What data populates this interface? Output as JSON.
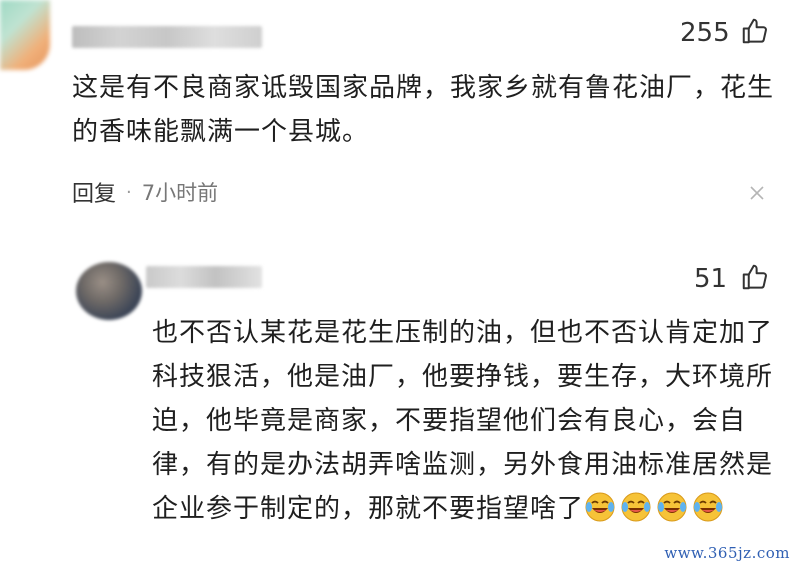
{
  "comments": [
    {
      "like_count": "255",
      "text": "这是有不良商家诋毁国家品牌，我家乡就有鲁花油厂，花生的香味能飘满一个县城。",
      "reply_label": "回复",
      "separator": "·",
      "time": "7小时前"
    },
    {
      "like_count": "51",
      "text": "也不否认某花是花生压制的油，但也不否认肯定加了科技狠活，他是油厂，他要挣钱，要生存，大环境所迫，他毕竟是商家，不要指望他们会有良心，会自律，有的是办法胡弄啥监测，另外食用油标准居然是企业参于制定的，那就不要指望啥了",
      "emoji_name": "laughing-crying-emoji",
      "emoji_count": 4
    }
  ],
  "icons": {
    "like": "thumbs-up-icon",
    "close": "close-icon"
  },
  "watermark": "www.365jz.com",
  "colors": {
    "text": "#1f1f1f",
    "meta": "#777777",
    "watermark": "#2f5fb3",
    "emoji_face": "#f6c338"
  }
}
